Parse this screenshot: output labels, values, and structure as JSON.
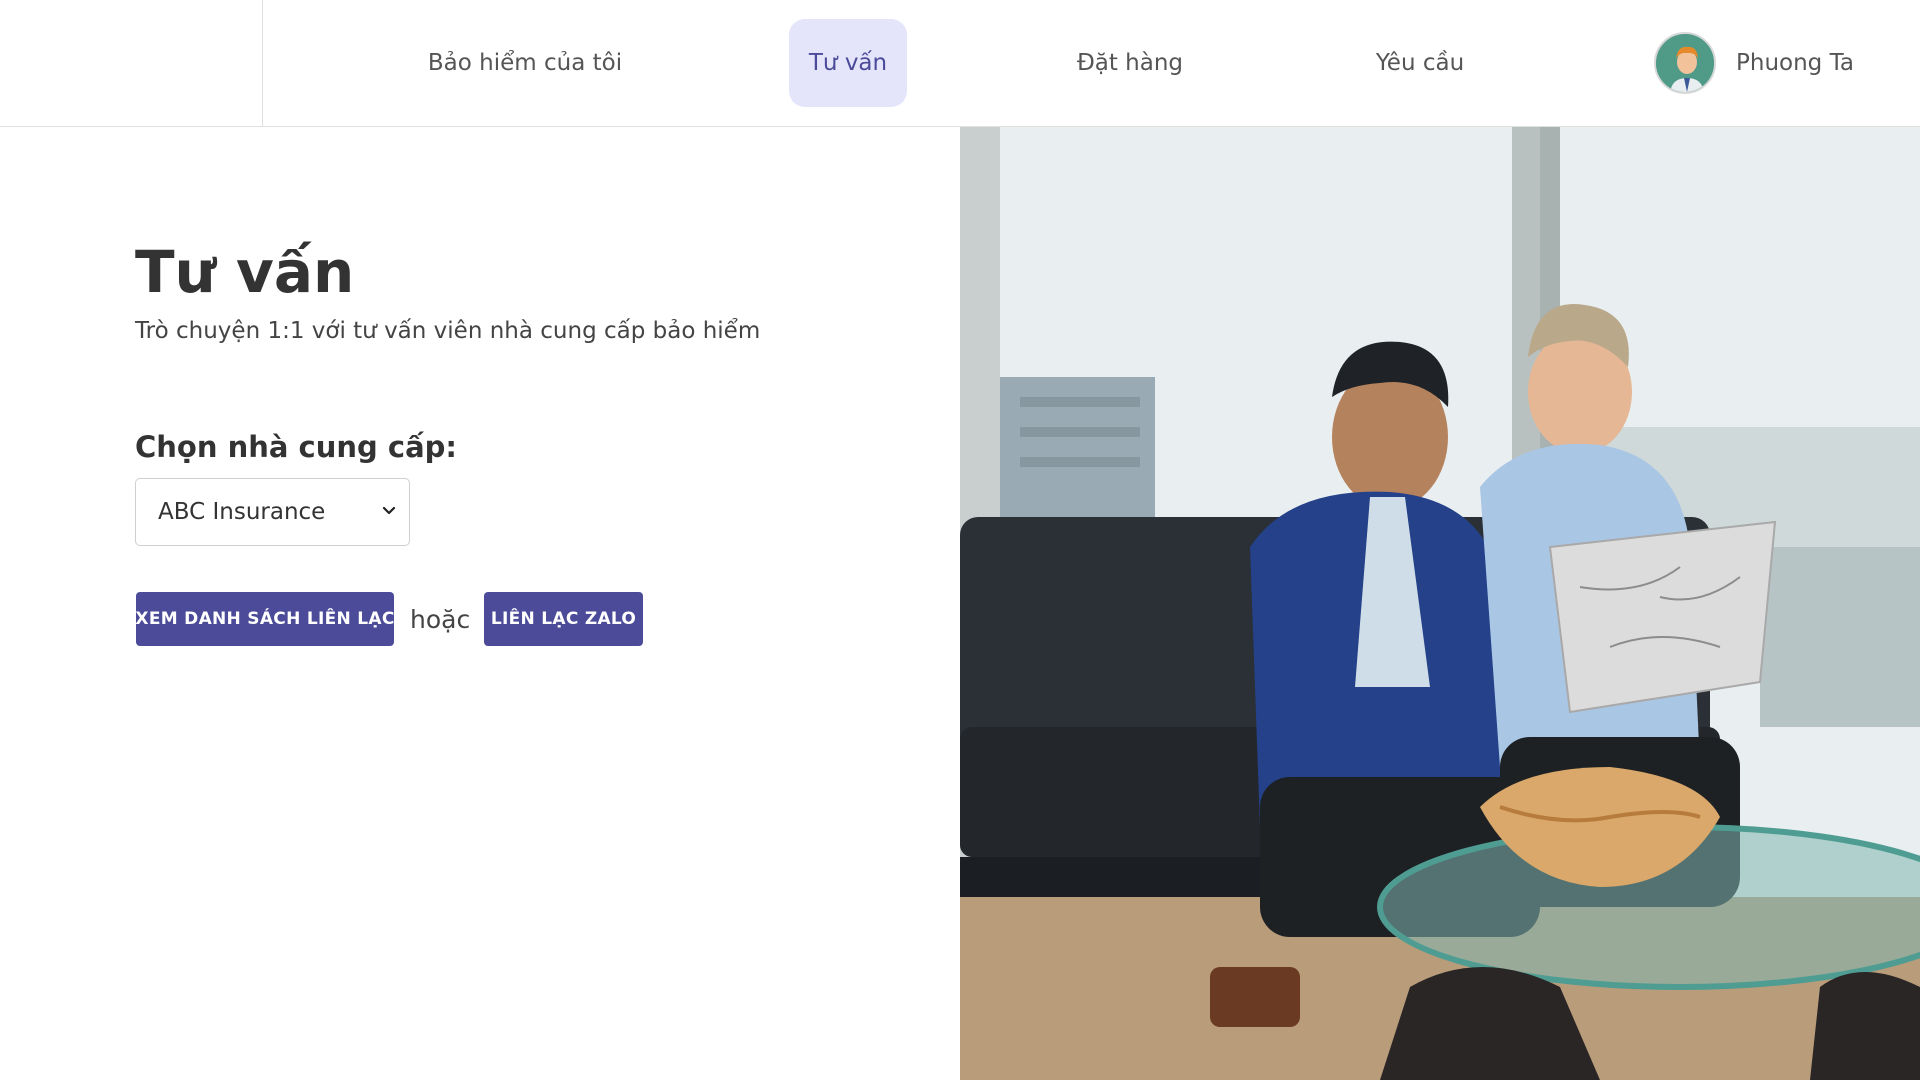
{
  "nav": {
    "items": [
      {
        "label": "Bảo hiểm của tôi"
      },
      {
        "label": "Tư vấn"
      },
      {
        "label": "Đặt hàng"
      },
      {
        "label": "Yêu cầu"
      }
    ],
    "active_index": 1,
    "user_name": "Phuong Ta"
  },
  "main": {
    "title": "Tư vấn",
    "subtitle": "Trò chuyện 1:1 với tư vấn viên nhà cung cấp bảo hiểm",
    "provider_label": "Chọn nhà cung cấp:",
    "provider_selected": "ABC Insurance",
    "button_list": "XEM DANH SÁCH LIÊN LẠC",
    "or_text": "hoặc",
    "button_zalo": "LIÊN LẠC ZALO"
  },
  "colors": {
    "accent": "#4b4b9a",
    "active_nav_bg": "#e4e4fb"
  },
  "icons": {
    "select": "chevron-down-icon",
    "avatar": "user-avatar"
  }
}
